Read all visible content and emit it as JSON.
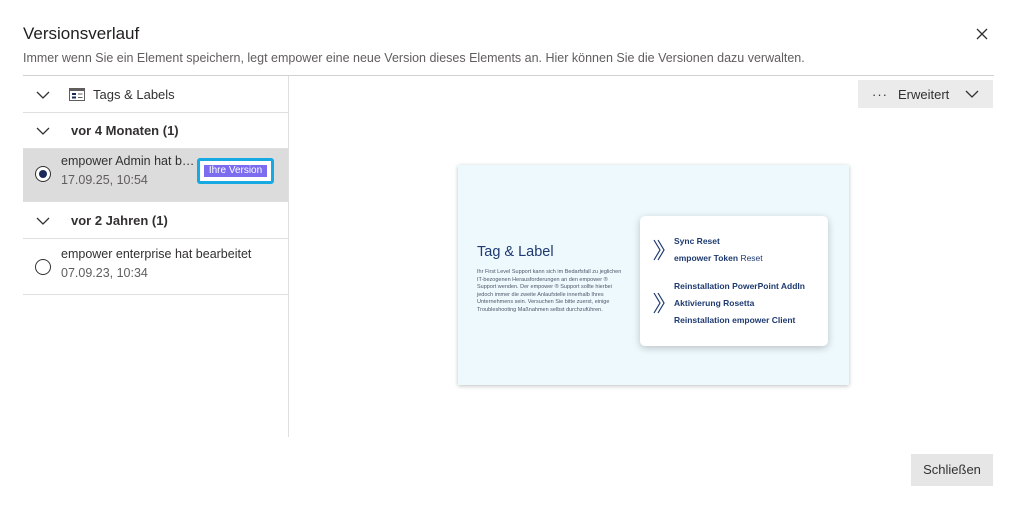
{
  "dialog": {
    "title": "Versionsverlauf",
    "subtitle": "Immer wenn Sie ein Element speichern, legt empower eine neue Version dieses Elements an. Hier können Sie die Versionen dazu verwalten.",
    "close_icon": "close-icon"
  },
  "filter": {
    "label": "Tags & Labels",
    "icon": "tag-label-icon"
  },
  "groups": [
    {
      "label": "vor 4 Monaten (1)",
      "versions": [
        {
          "title": "empower Admin hat bearbeitet",
          "date": "17.09.25, 10:54",
          "badge": "Ihre Version",
          "selected": true
        }
      ]
    },
    {
      "label": "vor 2 Jahren (1)",
      "versions": [
        {
          "title": "empower enterprise hat bearbeitet",
          "date": "07.09.23, 10:34",
          "selected": false
        }
      ]
    }
  ],
  "toolbar": {
    "more_label": "Erweitert",
    "dots": "···"
  },
  "preview": {
    "title": "Tag & Label",
    "body": "Ihr First Level Support kann sich im Bedarfsfall zu jeglichen IT-bezogenen Herausforderungen an den empower ® Support wenden. Der empower ® Support sollte hierbei jedoch immer die zweite Anlaufstelle innerhalb Ihres Unternehmens sein. Versuchen Sie bitte zuerst, einige Troubleshooting Maßnahmen selbst durchzuführen.",
    "card": {
      "line1": "Sync Reset",
      "line2_bold": "empower Token",
      "line2_rest": " Reset",
      "line3": "Reinstallation PowerPoint AddIn",
      "line4": "Aktivierung Rosetta",
      "line5": "Reinstallation empower Client"
    }
  },
  "footer": {
    "close_label": "Schließen"
  },
  "colors": {
    "badge_bg": "#7b6cf0",
    "badge_highlight": "#17a9e1",
    "selected_row": "#dcdcdc",
    "preview_navy": "#1e3a70"
  }
}
